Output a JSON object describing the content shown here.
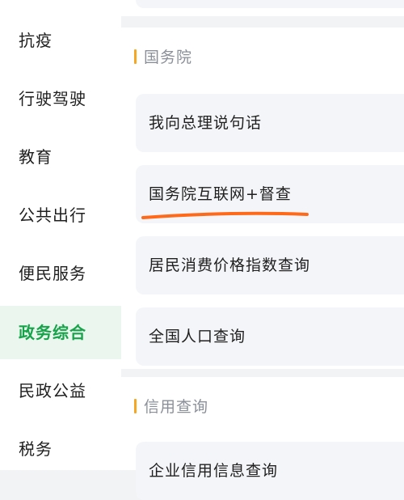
{
  "sidebar": {
    "items": [
      {
        "label": "抗疫"
      },
      {
        "label": "行驶驾驶"
      },
      {
        "label": "教育"
      },
      {
        "label": "公共出行"
      },
      {
        "label": "便民服务"
      },
      {
        "label": "政务综合",
        "active": true
      },
      {
        "label": "民政公益"
      },
      {
        "label": "税务"
      }
    ]
  },
  "main": {
    "sections": [
      {
        "title": "国务院",
        "items": [
          {
            "label": "我向总理说句话"
          },
          {
            "label": "国务院互联网+督查"
          },
          {
            "label": "居民消费价格指数查询"
          },
          {
            "label": "全国人口查询"
          }
        ]
      },
      {
        "title": "信用查询",
        "items": [
          {
            "label": "企业信用信息查询"
          }
        ]
      }
    ]
  },
  "colors": {
    "active_text": "#17a34a",
    "active_bg": "#eaf6ee",
    "accent_bar": "#f5a623",
    "annotation_underline": "#ff6a1a"
  }
}
